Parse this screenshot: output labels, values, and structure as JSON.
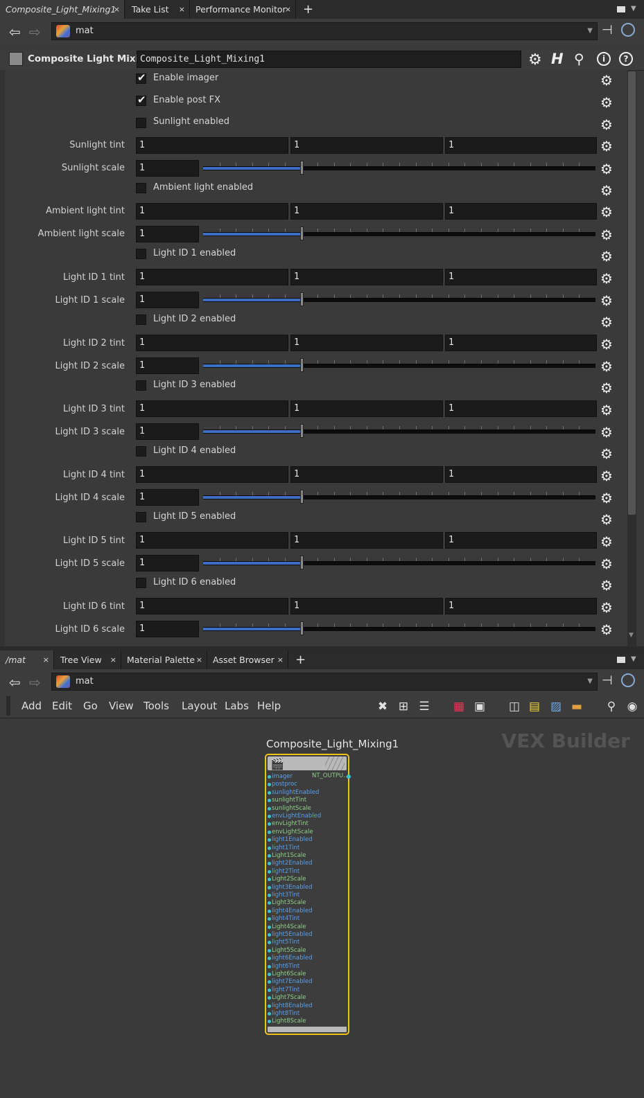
{
  "top_tabs": [
    {
      "label": "Composite_Light_Mixing1",
      "close": "×"
    },
    {
      "label": "Take List",
      "close": "×"
    },
    {
      "label": "Performance Monitor",
      "close": "×"
    }
  ],
  "tab_add": "+",
  "top_path": {
    "value": "mat"
  },
  "param_header": {
    "type_label": "Composite Light Mixing",
    "node_name": "Composite_Light_Mixing1"
  },
  "params": {
    "enable_imager": {
      "label": "Enable imager",
      "checked": true
    },
    "enable_postfx": {
      "label": "Enable post FX",
      "checked": true
    },
    "sunlight_enabled": {
      "label": "Sunlight enabled",
      "checked": false
    },
    "sunlight_tint": {
      "label": "Sunlight tint",
      "values": [
        "1",
        "1",
        "1"
      ]
    },
    "sunlight_scale": {
      "label": "Sunlight scale",
      "value": "1",
      "slider_fraction": 0.25
    },
    "ambient_enabled": {
      "label": "Ambient light enabled",
      "checked": false
    },
    "ambient_tint": {
      "label": "Ambient light tint",
      "values": [
        "1",
        "1",
        "1"
      ]
    },
    "ambient_scale": {
      "label": "Ambient light scale",
      "value": "1",
      "slider_fraction": 0.25
    },
    "light_ids": [
      {
        "enabled_label": "Light ID 1 enabled",
        "tint_label": "Light ID 1 tint",
        "scale_label": "Light ID 1 scale",
        "tint": [
          "1",
          "1",
          "1"
        ],
        "scale": "1",
        "slider_fraction": 0.25
      },
      {
        "enabled_label": "Light ID 2 enabled",
        "tint_label": "Light ID 2 tint",
        "scale_label": "Light ID 2 scale",
        "tint": [
          "1",
          "1",
          "1"
        ],
        "scale": "1",
        "slider_fraction": 0.25
      },
      {
        "enabled_label": "Light ID 3 enabled",
        "tint_label": "Light ID 3 tint",
        "scale_label": "Light ID 3 scale",
        "tint": [
          "1",
          "1",
          "1"
        ],
        "scale": "1",
        "slider_fraction": 0.25
      },
      {
        "enabled_label": "Light ID 4 enabled",
        "tint_label": "Light ID 4 tint",
        "scale_label": "Light ID 4 scale",
        "tint": [
          "1",
          "1",
          "1"
        ],
        "scale": "1",
        "slider_fraction": 0.25
      },
      {
        "enabled_label": "Light ID 5 enabled",
        "tint_label": "Light ID 5 tint",
        "scale_label": "Light ID 5 scale",
        "tint": [
          "1",
          "1",
          "1"
        ],
        "scale": "1",
        "slider_fraction": 0.25
      },
      {
        "enabled_label": "Light ID 6 enabled",
        "tint_label": "Light ID 6 tint",
        "scale_label": "Light ID 6 scale",
        "tint": [
          "1",
          "1",
          "1"
        ],
        "scale": "1",
        "slider_fraction": 0.25
      }
    ]
  },
  "bottom_tabs": [
    {
      "label": "/mat",
      "close": "×"
    },
    {
      "label": "Tree View",
      "close": "×"
    },
    {
      "label": "Material Palette",
      "close": "×"
    },
    {
      "label": "Asset Browser",
      "close": "×"
    }
  ],
  "bottom_path": {
    "value": "mat"
  },
  "network_menu": [
    "Add",
    "Edit",
    "Go",
    "View",
    "Tools",
    "Layout",
    "Labs",
    "Help"
  ],
  "network": {
    "context_label": "VEX Builder",
    "node": {
      "name": "Composite_Light_Mixing1",
      "output_port": "NT_OUTPU...",
      "input_ports": [
        "imager",
        "postproc",
        "sunlightEnabled",
        "sunlightTint",
        "sunlightScale",
        "envLightEnabled",
        "envLightTint",
        "envLightScale",
        "light1Enabled",
        "light1Tint",
        "Light1Scale",
        "light2Enabled",
        "light2Tint",
        "Light2Scale",
        "light3Enabled",
        "light3Tint",
        "Light3Scale",
        "light4Enabled",
        "light4Tint",
        "Light4Scale",
        "light5Enabled",
        "light5Tint",
        "Light5Scale",
        "light6Enabled",
        "light6Tint",
        "Light6Scale",
        "light7Enabled",
        "light7Tint",
        "Light7Scale",
        "light8Enabled",
        "light8Tint",
        "Light8Scale"
      ]
    }
  },
  "colors": {
    "accent_slider": "#3b6fc4",
    "node_selected_border": "#f0c21a",
    "port_blue": "#5aa0e8",
    "port_green": "#8fd08a"
  },
  "icons": [
    "back-arrow-icon",
    "forward-arrow-icon",
    "pin-icon",
    "link-icon",
    "gear-icon",
    "help-h-icon",
    "search-icon",
    "info-icon",
    "question-icon"
  ]
}
